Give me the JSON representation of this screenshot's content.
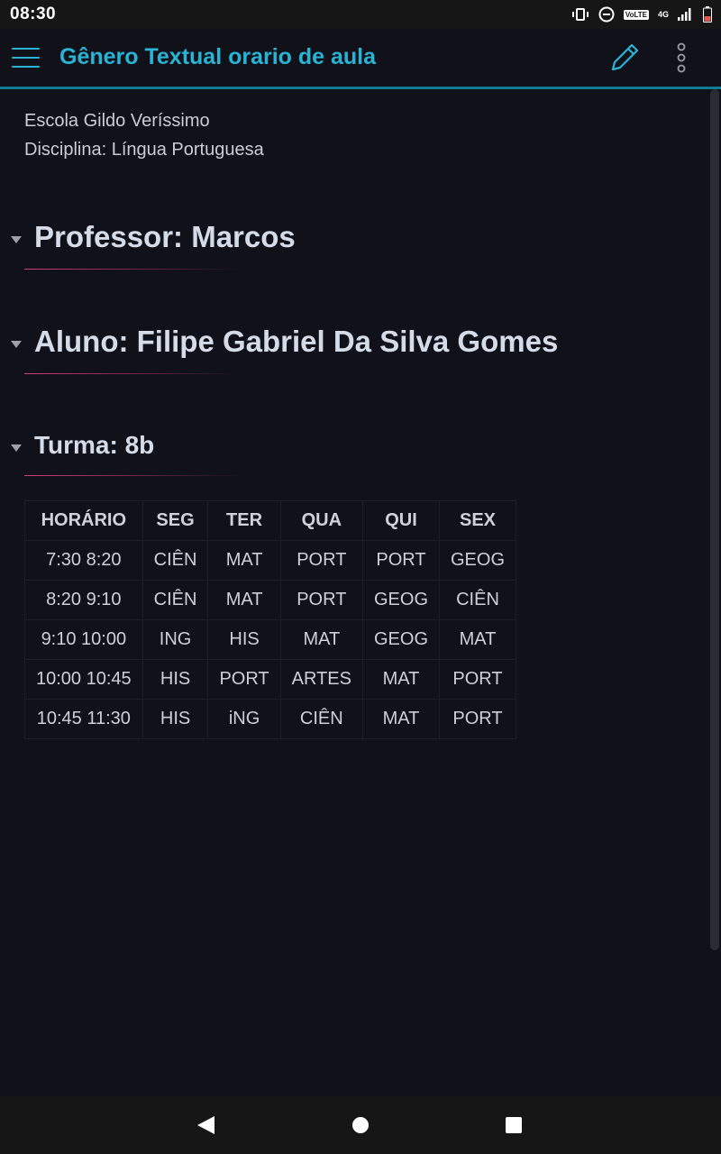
{
  "status_bar": {
    "time": "08:30",
    "volte": "VoLTE",
    "network": "4G",
    "icons": [
      "vibrate-icon",
      "do-not-disturb-icon",
      "volte-icon",
      "signal-icon",
      "battery-icon"
    ]
  },
  "toolbar": {
    "title": "Gênero Textual orario de aula",
    "menu_icon": "hamburger-menu-icon",
    "edit_icon": "pencil-icon",
    "more_icon": "more-vertical-icon",
    "accent_color": "#29b3d5"
  },
  "document": {
    "school": "Escola Gildo Veríssimo",
    "subject": "Disciplina: Língua Portuguesa",
    "headings": [
      {
        "text": "Professor: Marcos"
      },
      {
        "text": "Aluno: Filipe Gabriel Da Silva Gomes"
      },
      {
        "text": "Turma: 8b"
      }
    ],
    "heading_underline_color": "#d23e79"
  },
  "table": {
    "headers": [
      "HORÁRIO",
      "SEG",
      "TER",
      "QUA",
      "QUI",
      "SEX"
    ],
    "rows": [
      [
        "7:30 8:20",
        "CIÊN",
        "MAT",
        "PORT",
        "PORT",
        "GEOG"
      ],
      [
        "8:20 9:10",
        "CIÊN",
        "MAT",
        "PORT",
        "GEOG",
        "CIÊN"
      ],
      [
        "9:10 10:00",
        "ING",
        "HIS",
        "MAT",
        "GEOG",
        "MAT"
      ],
      [
        "10:00 10:45",
        "HIS",
        "PORT",
        "ARTES",
        "MAT",
        "PORT"
      ],
      [
        "10:45 11:30",
        "HIS",
        "iNG",
        "CIÊN",
        "MAT",
        "PORT"
      ]
    ]
  },
  "nav_bar": {
    "icons": [
      "back-icon",
      "home-icon",
      "recent-apps-icon"
    ]
  }
}
